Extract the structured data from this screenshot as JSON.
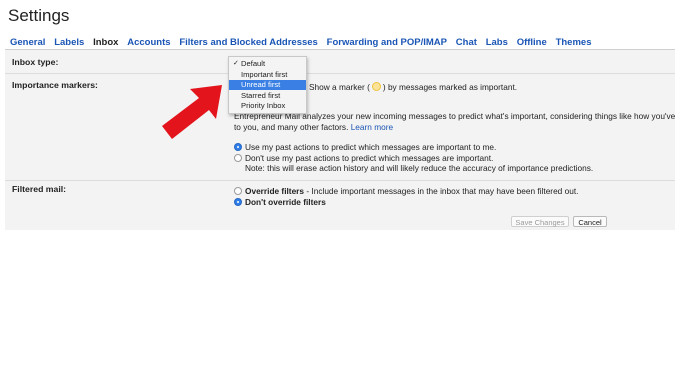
{
  "page": {
    "title": "Settings"
  },
  "tabs": [
    {
      "label": "General",
      "active": false
    },
    {
      "label": "Labels",
      "active": false
    },
    {
      "label": "Inbox",
      "active": true
    },
    {
      "label": "Accounts",
      "active": false
    },
    {
      "label": "Filters and Blocked Addresses",
      "active": false
    },
    {
      "label": "Forwarding and POP/IMAP",
      "active": false
    },
    {
      "label": "Chat",
      "active": false
    },
    {
      "label": "Labs",
      "active": false
    },
    {
      "label": "Offline",
      "active": false
    },
    {
      "label": "Themes",
      "active": false
    }
  ],
  "inbox_type": {
    "label": "Inbox type:",
    "options": [
      "Default",
      "Important first",
      "Unread first",
      "Starred first",
      "Priority Inbox"
    ],
    "selected": "Default",
    "highlighted": "Unread first"
  },
  "importance_markers": {
    "label": "Importance markers:",
    "show_marker_text_before": "Show a marker (",
    "show_marker_text_after": ") by messages marked as important.",
    "description_line1": "Entrepreneur Mail analyzes your new incoming messages to predict what's important, considering things like how you've",
    "description_line2": "to you, and many other factors.",
    "learn_more": "Learn more",
    "options": [
      {
        "label": "Use my past actions to predict which messages are important to me.",
        "checked": true
      },
      {
        "label": "Don't use my past actions to predict which messages are important.",
        "checked": false
      }
    ],
    "note": "Note: this will erase action history and will likely reduce the accuracy of importance predictions."
  },
  "filtered_mail": {
    "label": "Filtered mail:",
    "options": [
      {
        "label": "Override filters",
        "description": " - Include important messages in the inbox that may have been filtered out.",
        "checked": false
      },
      {
        "label": "Don't override filters",
        "description": "",
        "checked": true
      }
    ]
  },
  "actions": {
    "save": "Save Changes",
    "cancel": "Cancel"
  },
  "colors": {
    "accent": "#1a55b5",
    "highlight": "#3a80e4",
    "arrow": "#e3141b",
    "marker": "#fbe49a"
  }
}
